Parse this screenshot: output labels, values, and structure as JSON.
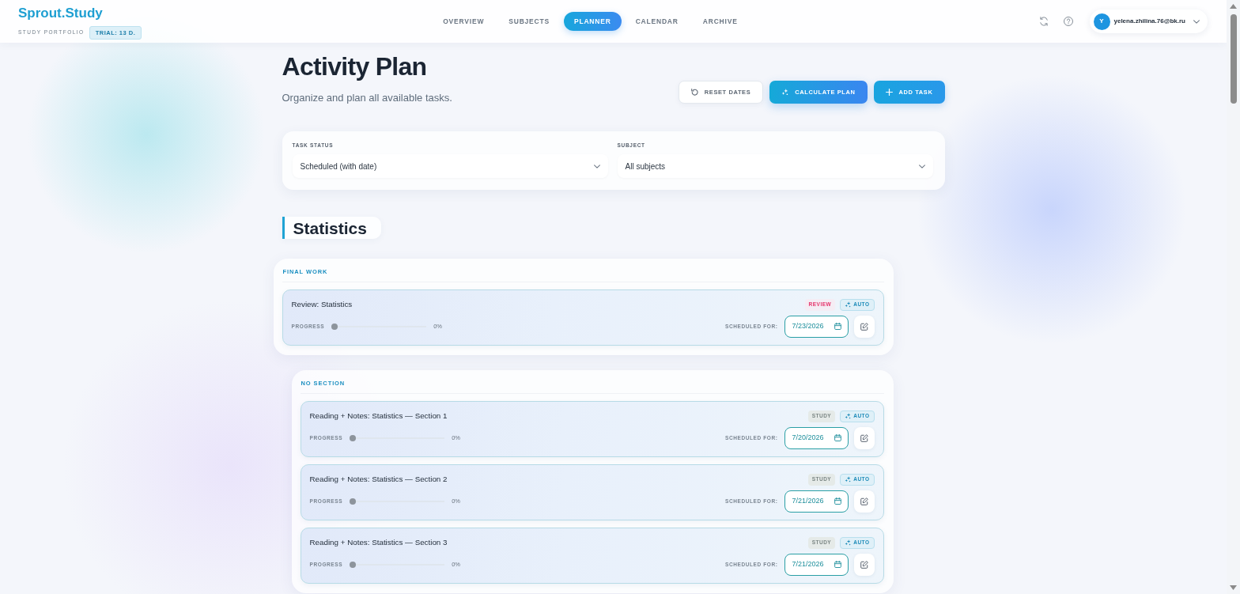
{
  "header": {
    "logo": "Sprout.Study",
    "tagline": "STUDY PORTFOLIO",
    "trial_badge": "TRIAL: 13 D.",
    "nav": [
      {
        "label": "OVERVIEW",
        "selected": false
      },
      {
        "label": "SUBJECTS",
        "selected": false
      },
      {
        "label": "PLANNER",
        "selected": true
      },
      {
        "label": "CALENDAR",
        "selected": false
      },
      {
        "label": "ARCHIVE",
        "selected": false
      }
    ],
    "user": {
      "initial": "Y",
      "email": "yelena.zhilina.76@bk.ru"
    }
  },
  "page": {
    "title": "Activity Plan",
    "subtitle": "Organize and plan all available tasks.",
    "actions": [
      {
        "kind": "reset",
        "label": "RESET DATES"
      },
      {
        "kind": "calculate",
        "label": "CALCULATE PLAN"
      },
      {
        "kind": "add",
        "label": "ADD TASK"
      }
    ]
  },
  "filters": [
    {
      "label": "TASK STATUS",
      "value": "Scheduled (with date)"
    },
    {
      "label": "SUBJECT",
      "value": "All subjects"
    }
  ],
  "subject": {
    "title": "Statistics",
    "groups": [
      {
        "kind": "final",
        "title": "FINAL WORK",
        "tasks": [
          {
            "title": "Review: Statistics",
            "tag": {
              "kind": "review",
              "label": "REVIEW"
            },
            "auto_tag": "AUTO",
            "progress_label": "PROGRESS",
            "level": 0,
            "reading": "0%",
            "scheduled_label": "SCHEDULED FOR:",
            "date": "7/23/2026"
          }
        ]
      },
      {
        "kind": "section",
        "title": "NO SECTION",
        "tasks": [
          {
            "title": "Reading + Notes: Statistics — Section 1",
            "tag": {
              "kind": "study",
              "label": "STUDY"
            },
            "auto_tag": "AUTO",
            "progress_label": "PROGRESS",
            "level": 0,
            "reading": "0%",
            "scheduled_label": "SCHEDULED FOR:",
            "date": "7/20/2026"
          },
          {
            "title": "Reading + Notes: Statistics — Section 2",
            "tag": {
              "kind": "study",
              "label": "STUDY"
            },
            "auto_tag": "AUTO",
            "progress_label": "PROGRESS",
            "level": 0,
            "reading": "0%",
            "scheduled_label": "SCHEDULED FOR:",
            "date": "7/21/2026"
          },
          {
            "title": "Reading + Notes: Statistics — Section 3",
            "tag": {
              "kind": "study",
              "label": "STUDY"
            },
            "auto_tag": "AUTO",
            "progress_label": "PROGRESS",
            "level": 0,
            "reading": "0%",
            "scheduled_label": "SCHEDULED FOR:",
            "date": "7/21/2026"
          }
        ]
      }
    ]
  }
}
